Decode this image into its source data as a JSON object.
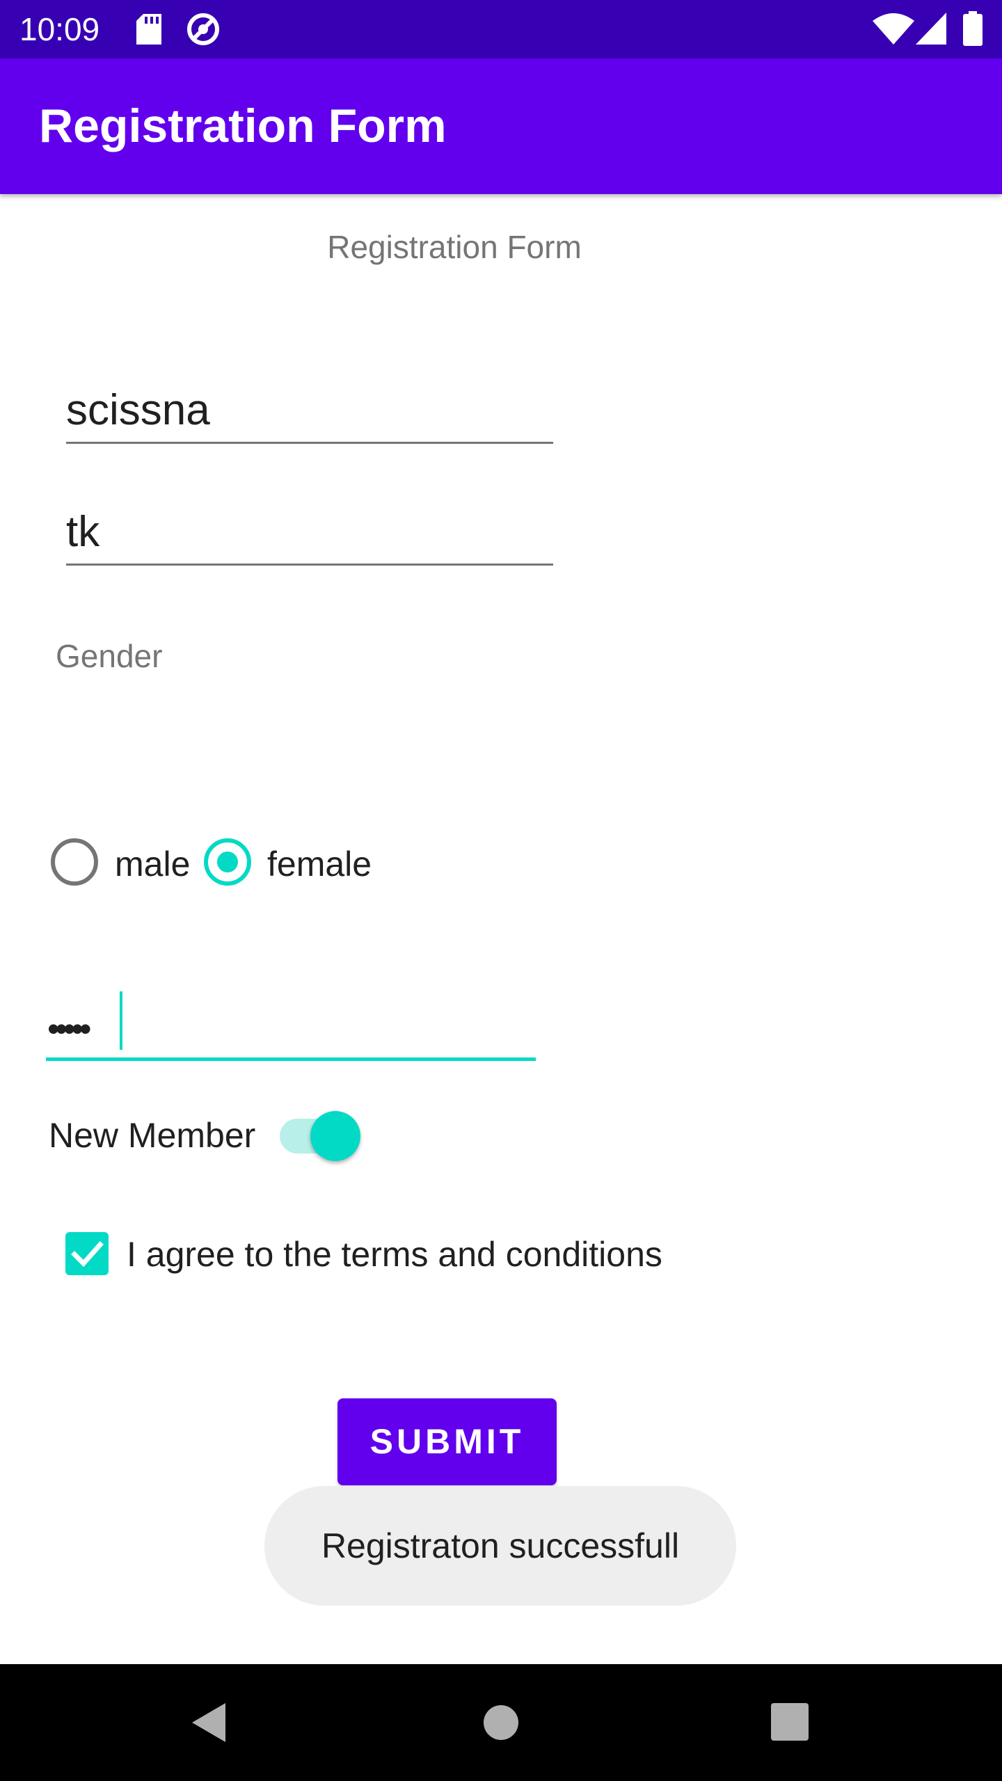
{
  "status_bar": {
    "time": "10:09",
    "icons": [
      "sd-card-icon",
      "sync-icon",
      "wifi-icon",
      "signal-icon",
      "battery-icon"
    ],
    "background": "#3700b3"
  },
  "app_bar": {
    "title": "Registration Form",
    "background": "#6200ee"
  },
  "form": {
    "heading": "Registration Form",
    "first_name_value": "scissna",
    "last_name_value": "tk",
    "gender_label": "Gender",
    "gender_options": [
      {
        "label": "male",
        "checked": false
      },
      {
        "label": "female",
        "checked": true
      }
    ],
    "password_value": "•••••",
    "new_member_label": "New Member",
    "new_member_on": true,
    "terms_label": "I agree to the terms and conditions",
    "terms_checked": true,
    "submit_label": "SUBMIT",
    "accent_color": "#03dac5"
  },
  "toast": {
    "message": "Registraton successfull"
  },
  "nav_bar": {
    "icons": [
      "back-icon",
      "home-icon",
      "recents-icon"
    ]
  }
}
